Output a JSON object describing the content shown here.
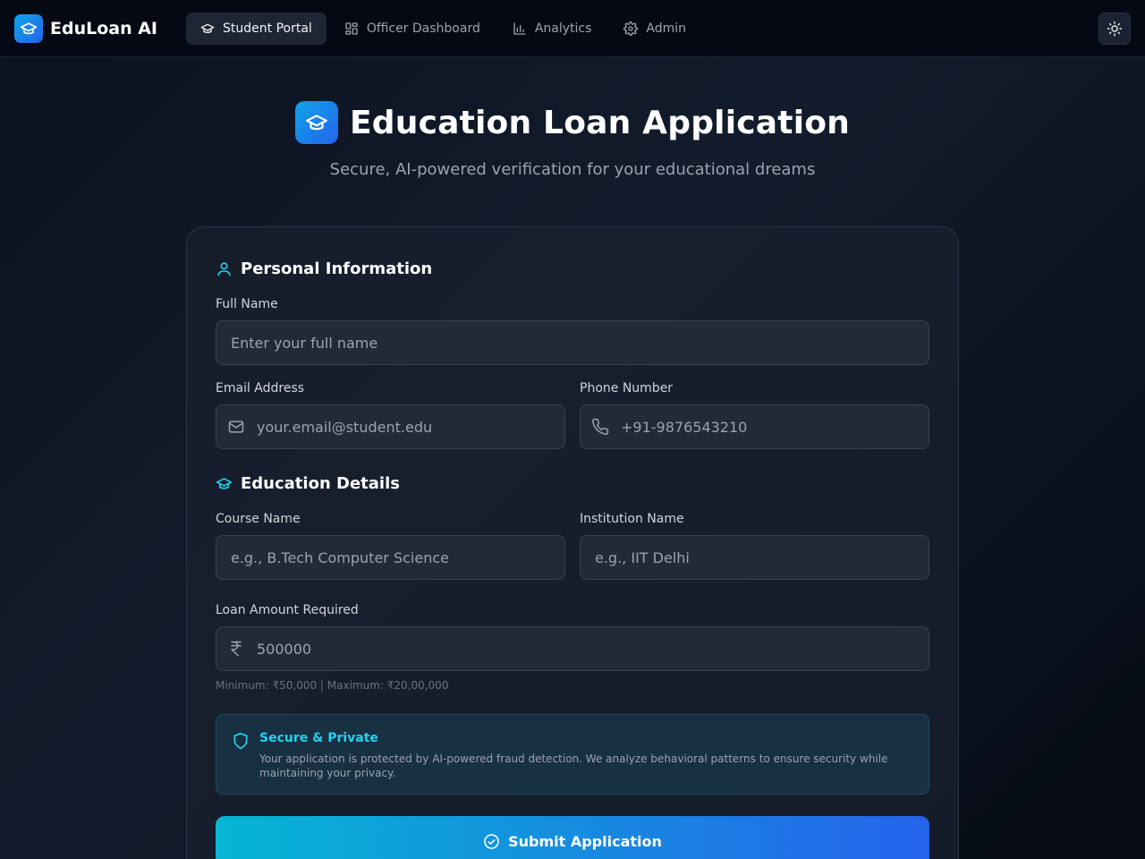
{
  "nav": {
    "brand": "EduLoan AI",
    "tabs": [
      {
        "label": "Student Portal",
        "active": true,
        "icon": "graduation-cap-icon"
      },
      {
        "label": "Officer Dashboard",
        "active": false,
        "icon": "dashboard-grid-icon"
      },
      {
        "label": "Analytics",
        "active": false,
        "icon": "bar-chart-icon"
      },
      {
        "label": "Admin",
        "active": false,
        "icon": "gear-icon"
      }
    ],
    "theme_toggle_icon": "sun-icon"
  },
  "hero": {
    "title": "Education Loan Application",
    "subtitle": "Secure, AI-powered verification for your educational dreams"
  },
  "form": {
    "personal": {
      "title": "Personal Information",
      "full_name_label": "Full Name",
      "full_name_placeholder": "Enter your full name",
      "email_label": "Email Address",
      "email_placeholder": "your.email@student.edu",
      "phone_label": "Phone Number",
      "phone_placeholder": "+91-9876543210"
    },
    "education": {
      "title": "Education Details",
      "course_label": "Course Name",
      "course_placeholder": "e.g., B.Tech Computer Science",
      "institution_label": "Institution Name",
      "institution_placeholder": "e.g., IIT Delhi",
      "loan_label": "Loan Amount Required",
      "loan_placeholder": "500000",
      "loan_hint": "Minimum: ₹50,000 | Maximum: ₹20,00,000"
    },
    "secure": {
      "title": "Secure & Private",
      "text": "Your application is protected by AI-powered fraud detection. We analyze behavioral patterns to ensure security while maintaining your privacy."
    },
    "submit_label": "Submit Application"
  },
  "colors": {
    "accent": "#22d3ee",
    "button_start": "#06b6d4",
    "button_end": "#2563eb"
  }
}
